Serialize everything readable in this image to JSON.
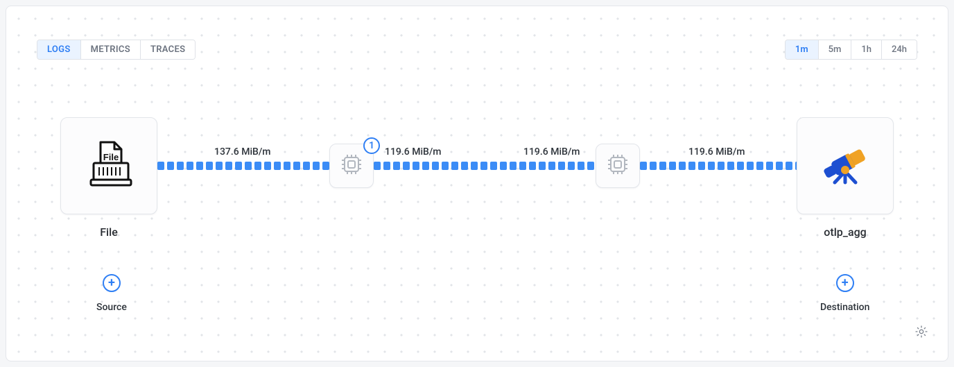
{
  "typeTabs": {
    "logs": "LOGS",
    "metrics": "METRICS",
    "traces": "TRACES",
    "active": "logs"
  },
  "timeTabs": {
    "t1m": "1m",
    "t5m": "5m",
    "t1h": "1h",
    "t24h": "24h",
    "active": "t1m"
  },
  "flow": {
    "rate1": "137.6 MiB/m",
    "rate2": "119.6 MiB/m",
    "rate3": "119.6 MiB/m",
    "rate4": "119.6 MiB/m"
  },
  "nodes": {
    "source": {
      "label": "File"
    },
    "processor1": {
      "badge": "1"
    },
    "destination": {
      "label": "otlp_agg"
    }
  },
  "addButtons": {
    "source": "Source",
    "destination": "Destination"
  }
}
